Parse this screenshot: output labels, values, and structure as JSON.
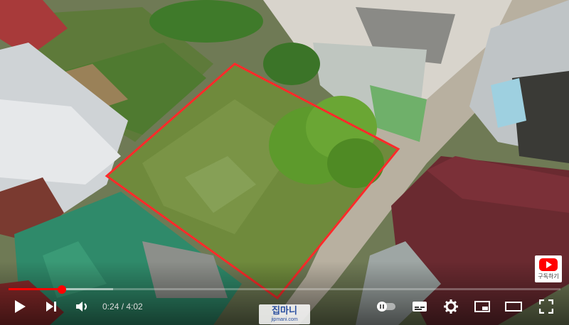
{
  "video": {
    "current_time": "0:24",
    "separator": " / ",
    "duration": "4:02",
    "progress_fraction": 0.097,
    "buffered_fraction": 0.19
  },
  "subscribe": {
    "label": "구독하기"
  },
  "watermark": {
    "brand": "집마니",
    "site": "jipmani.com"
  },
  "colors": {
    "accent": "#ff0000",
    "plot_outline": "#ff2a2a",
    "control_icon": "#ffffff"
  },
  "icons": {
    "play": "play-icon",
    "next": "next-icon",
    "volume": "volume-icon",
    "autoplay": "autoplay-toggle-icon",
    "subtitles": "subtitles-icon",
    "settings": "gear-icon",
    "miniplayer": "miniplayer-icon",
    "theater": "theater-mode-icon",
    "fullscreen": "fullscreen-icon"
  }
}
